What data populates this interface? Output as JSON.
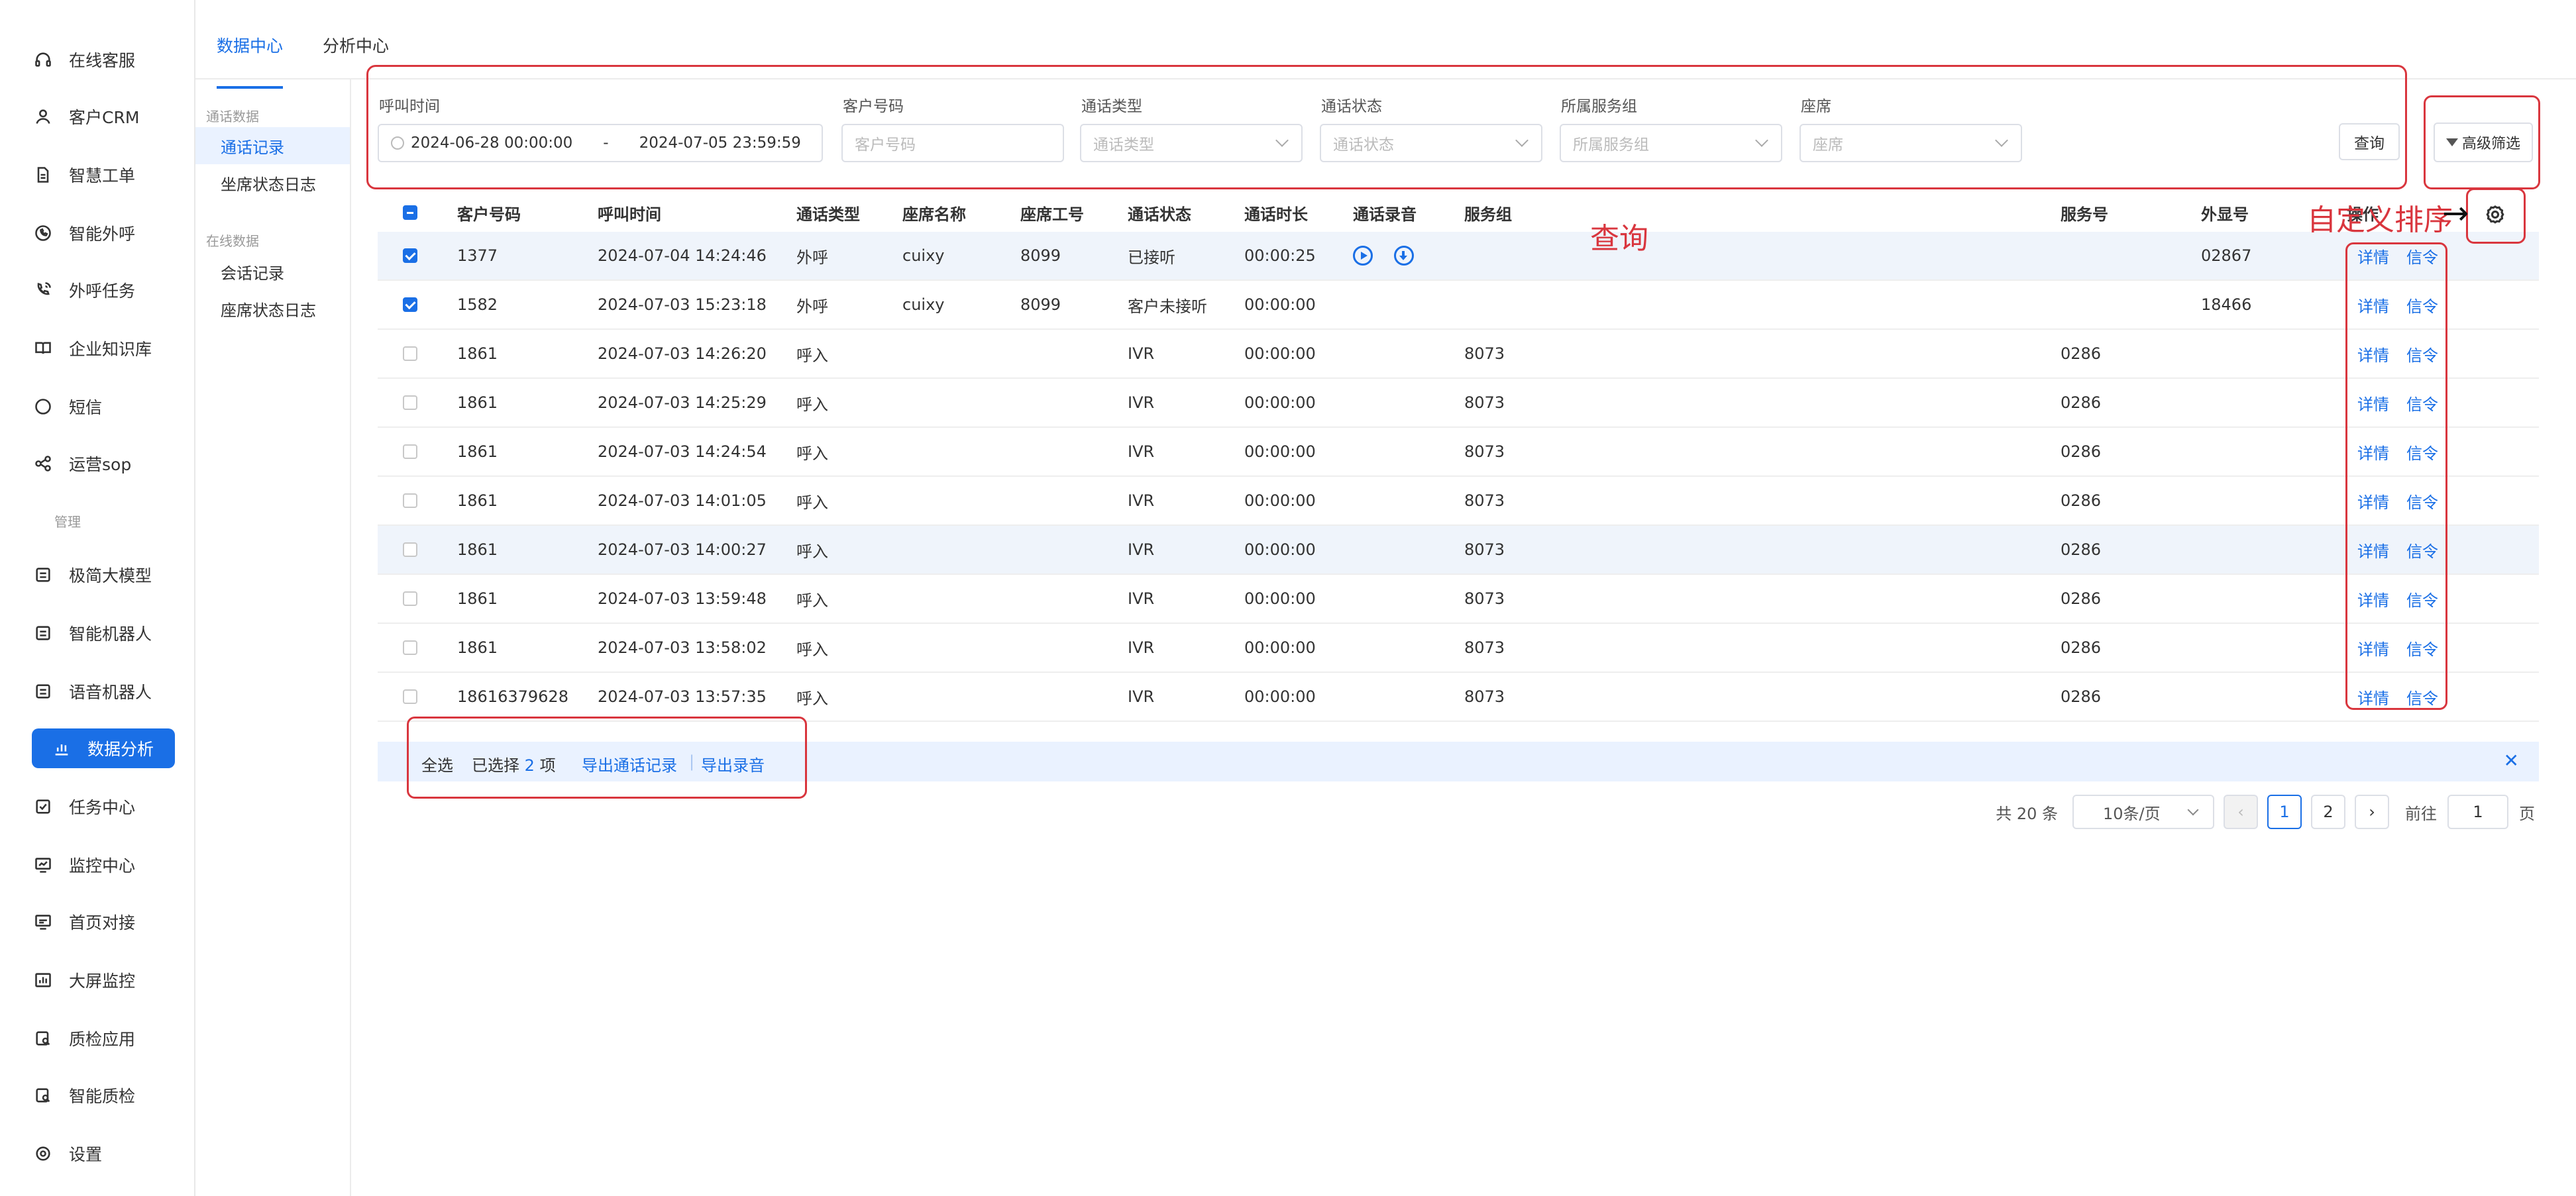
{
  "nav": {
    "items": [
      {
        "label": "在线客服",
        "icon": "headset-icon"
      },
      {
        "label": "客户CRM",
        "icon": "user-icon"
      },
      {
        "label": "智慧工单",
        "icon": "document-icon"
      },
      {
        "label": "智能外呼",
        "icon": "phone-chat-icon"
      },
      {
        "label": "外呼任务",
        "icon": "phone-waves-icon"
      },
      {
        "label": "企业知识库",
        "icon": "book-icon"
      },
      {
        "label": "短信",
        "icon": "sms-icon"
      },
      {
        "label": "运营sop",
        "icon": "share-nodes-icon"
      }
    ],
    "group_label": "管理",
    "items2": [
      {
        "label": "极简大模型",
        "icon": "robot-icon"
      },
      {
        "label": "智能机器人",
        "icon": "robot-icon"
      },
      {
        "label": "语音机器人",
        "icon": "robot-icon"
      },
      {
        "label": "数据分析",
        "icon": "bar-chart-icon"
      },
      {
        "label": "任务中心",
        "icon": "task-check-icon"
      },
      {
        "label": "监控中心",
        "icon": "monitor-icon"
      },
      {
        "label": "首页对接",
        "icon": "monitor-chart-icon"
      },
      {
        "label": "大屏监控",
        "icon": "dashboard-icon"
      },
      {
        "label": "质检应用",
        "icon": "quality-check-icon"
      },
      {
        "label": "智能质检",
        "icon": "quality-check-icon"
      },
      {
        "label": "设置",
        "icon": "settings-icon"
      }
    ]
  },
  "tabs": [
    "数据中心",
    "分析中心"
  ],
  "subnav": {
    "group1": "通话数据",
    "group1_items": [
      "通话记录",
      "坐席状态日志"
    ],
    "group2": "在线数据",
    "group2_items": [
      "会话记录",
      "座席状态日志"
    ]
  },
  "filters": {
    "call_time_label": "呼叫时间",
    "date_start": "2024-06-28 00:00:00",
    "date_sep": "-",
    "date_end": "2024-07-05 23:59:59",
    "customer_label": "客户号码",
    "customer_placeholder": "客户号码",
    "call_type_label": "通话类型",
    "call_type_placeholder": "通话类型",
    "call_status_label": "通话状态",
    "call_status_placeholder": "通话状态",
    "service_group_label": "所属服务组",
    "service_group_placeholder": "所属服务组",
    "seat_label": "座席",
    "seat_placeholder": "座席",
    "query_button": "查询",
    "advanced_button": "高级筛选"
  },
  "table": {
    "columns": [
      "客户号码",
      "呼叫时间",
      "通话类型",
      "座席名称",
      "座席工号",
      "通话状态",
      "通话时长",
      "通话录音",
      "服务组",
      "服务号",
      "外显号",
      "操作"
    ],
    "rows": [
      {
        "phone": "1377",
        "time": "2024-07-04 14:24:46",
        "type": "外呼",
        "seat_name": "cuixy",
        "seat_no": "8099",
        "status": "已接听",
        "duration": "00:00:25",
        "recording": true,
        "group": "",
        "service_no": "",
        "caller_id": "02867",
        "checked": true
      },
      {
        "phone": "1582",
        "time": "2024-07-03 15:23:18",
        "type": "外呼",
        "seat_name": "cuixy",
        "seat_no": "8099",
        "status": "客户未接听",
        "duration": "00:00:00",
        "recording": false,
        "group": "",
        "service_no": "",
        "caller_id": "18466",
        "checked": true
      },
      {
        "phone": "1861",
        "time": "2024-07-03 14:26:20",
        "type": "呼入",
        "seat_name": "",
        "seat_no": "",
        "status": "IVR",
        "duration": "00:00:00",
        "recording": false,
        "group": "8073",
        "service_no": "0286",
        "caller_id": "",
        "checked": false
      },
      {
        "phone": "1861",
        "time": "2024-07-03 14:25:29",
        "type": "呼入",
        "seat_name": "",
        "seat_no": "",
        "status": "IVR",
        "duration": "00:00:00",
        "recording": false,
        "group": "8073",
        "service_no": "0286",
        "caller_id": "",
        "checked": false
      },
      {
        "phone": "1861",
        "time": "2024-07-03 14:24:54",
        "type": "呼入",
        "seat_name": "",
        "seat_no": "",
        "status": "IVR",
        "duration": "00:00:00",
        "recording": false,
        "group": "8073",
        "service_no": "0286",
        "caller_id": "",
        "checked": false
      },
      {
        "phone": "1861",
        "time": "2024-07-03 14:01:05",
        "type": "呼入",
        "seat_name": "",
        "seat_no": "",
        "status": "IVR",
        "duration": "00:00:00",
        "recording": false,
        "group": "8073",
        "service_no": "0286",
        "caller_id": "",
        "checked": false
      },
      {
        "phone": "1861",
        "time": "2024-07-03 14:00:27",
        "type": "呼入",
        "seat_name": "",
        "seat_no": "",
        "status": "IVR",
        "duration": "00:00:00",
        "recording": false,
        "group": "8073",
        "service_no": "0286",
        "caller_id": "",
        "checked": false
      },
      {
        "phone": "1861",
        "time": "2024-07-03 13:59:48",
        "type": "呼入",
        "seat_name": "",
        "seat_no": "",
        "status": "IVR",
        "duration": "00:00:00",
        "recording": false,
        "group": "8073",
        "service_no": "0286",
        "caller_id": "",
        "checked": false
      },
      {
        "phone": "1861",
        "time": "2024-07-03 13:58:02",
        "type": "呼入",
        "seat_name": "",
        "seat_no": "",
        "status": "IVR",
        "duration": "00:00:00",
        "recording": false,
        "group": "8073",
        "service_no": "0286",
        "caller_id": "",
        "checked": false
      },
      {
        "phone": "18616379628",
        "time": "2024-07-03 13:57:35",
        "type": "呼入",
        "seat_name": "",
        "seat_no": "",
        "status": "IVR",
        "duration": "00:00:00",
        "recording": false,
        "group": "8073",
        "service_no": "0286",
        "caller_id": "",
        "checked": false
      }
    ],
    "action_detail": "详情",
    "action_signal": "信令"
  },
  "annotations": {
    "query": "查询",
    "custom_sort": "自定义排序",
    "arrow": "→"
  },
  "selection_bar": {
    "select_all": "全选",
    "selected_prefix": "已选择",
    "selected_count": "2",
    "selected_suffix": "项",
    "export_calls": "导出通话记录",
    "separator": "|",
    "export_recordings": "导出录音",
    "close": "✕"
  },
  "pagination": {
    "total": "共 20 条",
    "page_size": "10条/页",
    "prev": "‹",
    "pages": [
      "1",
      "2"
    ],
    "next": "›",
    "goto_label": "前往",
    "goto_value": "1",
    "page_suffix": "页"
  },
  "colors": {
    "accent": "#1a6fe6",
    "annotation": "#d9363e"
  }
}
